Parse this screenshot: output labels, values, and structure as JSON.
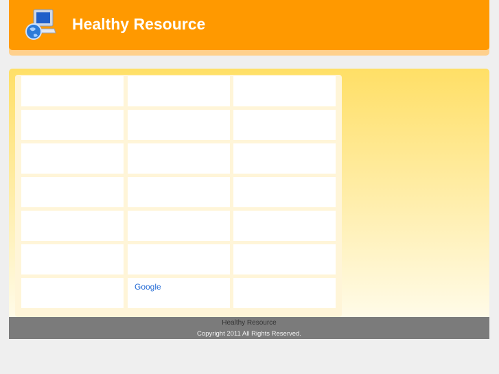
{
  "header": {
    "title": "Healthy Resource",
    "logo_icon": "computer-globe-icon"
  },
  "main": {
    "link": "Google"
  },
  "footer": {
    "site": "Healthy Resource",
    "copyright": "Copyright 2011  All Rights Reserved."
  }
}
